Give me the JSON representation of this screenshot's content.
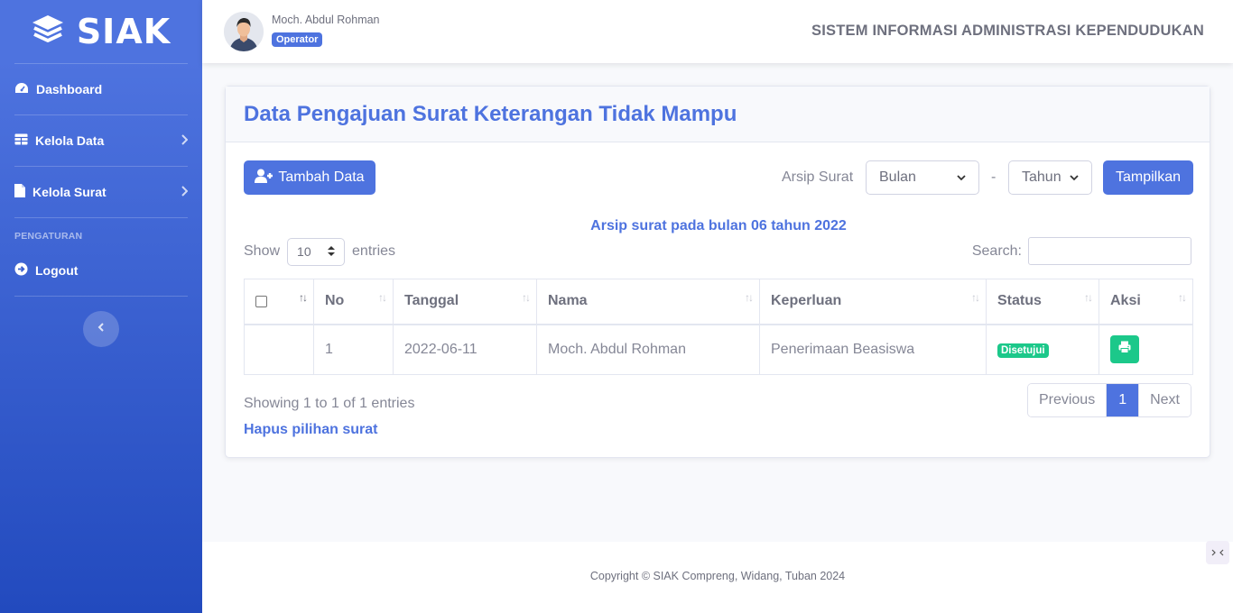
{
  "brand": {
    "name": "SIAK"
  },
  "sidebar": {
    "items": [
      {
        "label": "Dashboard"
      },
      {
        "label": "Kelola Data"
      },
      {
        "label": "Kelola Surat"
      }
    ],
    "heading": "PENGATURAN",
    "logout_label": "Logout"
  },
  "topbar": {
    "user_name": "Moch. Abdul Rohman",
    "role": "Operator",
    "system_title": "SISTEM INFORMASI ADMINISTRASI KEPENDUDUKAN"
  },
  "card": {
    "title": "Data Pengajuan Surat Keterangan Tidak Mampu",
    "add_label": "Tambah Data",
    "arsip_label": "Arsip Surat",
    "month_select": "Bulan",
    "separator": "-",
    "year_select": "Tahun",
    "show_button": "Tampilkan",
    "arsip_info": "Arsip surat pada bulan 06 tahun 2022",
    "show_label": "Show",
    "entries_value": "10",
    "entries_label": "entries",
    "search_label": "Search:",
    "search_value": ""
  },
  "table": {
    "columns": [
      "No",
      "Tanggal",
      "Nama",
      "Keperluan",
      "Status",
      "Aksi"
    ],
    "rows": [
      {
        "no": "1",
        "tanggal": "2022-06-11",
        "nama": "Moch. Abdul Rohman",
        "keperluan": "Penerimaan Beasiswa",
        "status": "Disetujui"
      }
    ]
  },
  "footer_info": {
    "showing": "Showing 1 to 1 of 1 entries",
    "delete_selected": "Hapus pilihan surat",
    "prev": "Previous",
    "page": "1",
    "next": "Next"
  },
  "footer": {
    "copyright": "Copyright © SIAK Compreng, Widang, Tuban 2024"
  },
  "colors": {
    "primary": "#4e73df",
    "success": "#1cc88a",
    "text": "#858796"
  }
}
